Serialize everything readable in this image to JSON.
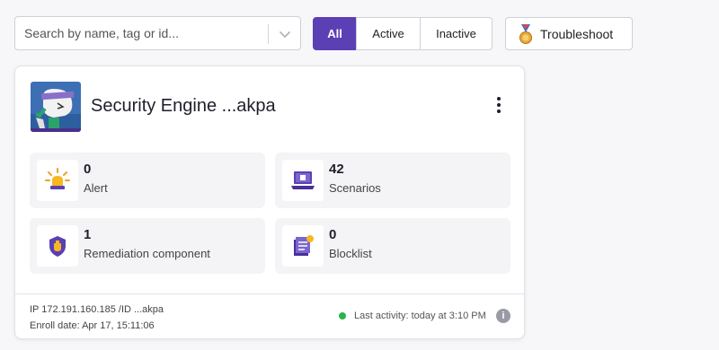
{
  "search": {
    "placeholder": "Search by name, tag or id...",
    "value": ""
  },
  "filters": {
    "all": "All",
    "active": "Active",
    "inactive": "Inactive",
    "selected": "All"
  },
  "toolbar": {
    "troubleshoot_label": "Troubleshoot"
  },
  "card": {
    "title": "Security Engine ...akpa",
    "stats": {
      "alert": {
        "value": "0",
        "label": "Alert",
        "icon": "alarm-light-icon"
      },
      "scenarios": {
        "value": "42",
        "label": "Scenarios",
        "icon": "laptop-icon"
      },
      "remediation": {
        "value": "1",
        "label": "Remediation component",
        "icon": "shield-fist-icon"
      },
      "blocklist": {
        "value": "0",
        "label": "Blocklist",
        "icon": "blocklist-icon"
      }
    },
    "footer": {
      "ip_line": "IP 172.191.160.185 /ID ...akpa",
      "enroll_line": "Enroll date: Apr 17, 15:11:06",
      "last_activity": "Last activity: today at 3:10 PM",
      "status_color": "#2cb34a",
      "info_glyph": "i"
    }
  },
  "colors": {
    "accent": "#5a3fb5"
  }
}
